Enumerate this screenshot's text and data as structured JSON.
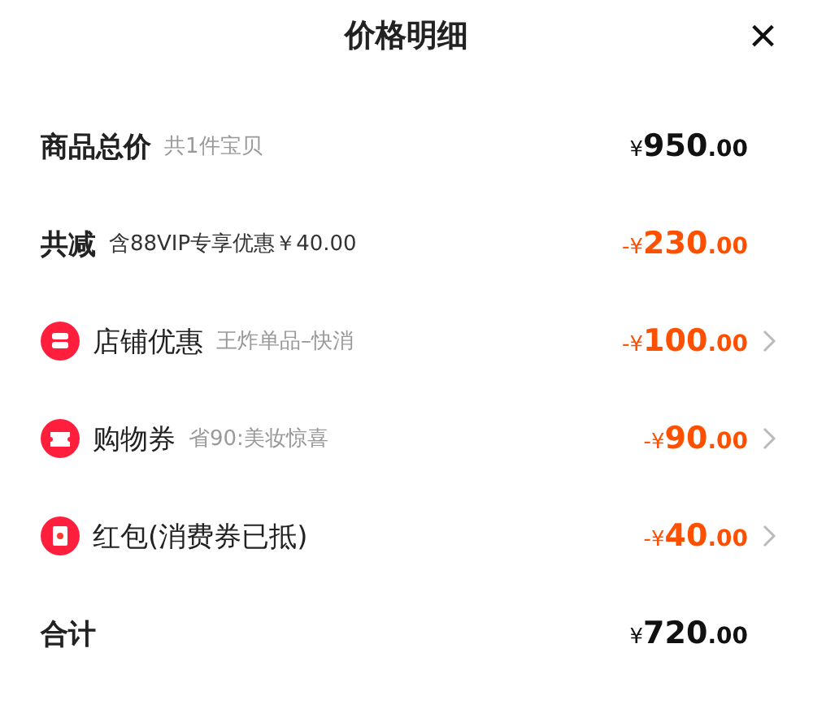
{
  "header": {
    "title": "价格明细",
    "close": "×"
  },
  "rows": [
    {
      "kind": "total",
      "label": "商品总价",
      "note": "共1件宝贝",
      "price": {
        "sign": "¥",
        "whole": "950",
        "cents": ".00"
      }
    },
    {
      "kind": "reduction",
      "label": "共减",
      "note": "含88VIP专享优惠￥40.00",
      "price": {
        "sign": "-¥",
        "whole": "230",
        "cents": ".00"
      }
    },
    {
      "kind": "discount",
      "label": "店铺优惠",
      "note": "王炸单品–快消",
      "price": {
        "sign": "-¥",
        "whole": "100",
        "cents": ".00"
      }
    },
    {
      "kind": "discount",
      "label": "购物券",
      "note": "省90:美妆惊喜",
      "price": {
        "sign": "-¥",
        "whole": "90",
        "cents": ".00"
      }
    },
    {
      "kind": "discount",
      "label": "红包(消费券已抵)",
      "price": {
        "sign": "-¥",
        "whole": "40",
        "cents": ".00"
      }
    },
    {
      "kind": "total",
      "label": "合计",
      "price": {
        "sign": "¥",
        "whole": "720",
        "cents": ".00"
      }
    }
  ]
}
